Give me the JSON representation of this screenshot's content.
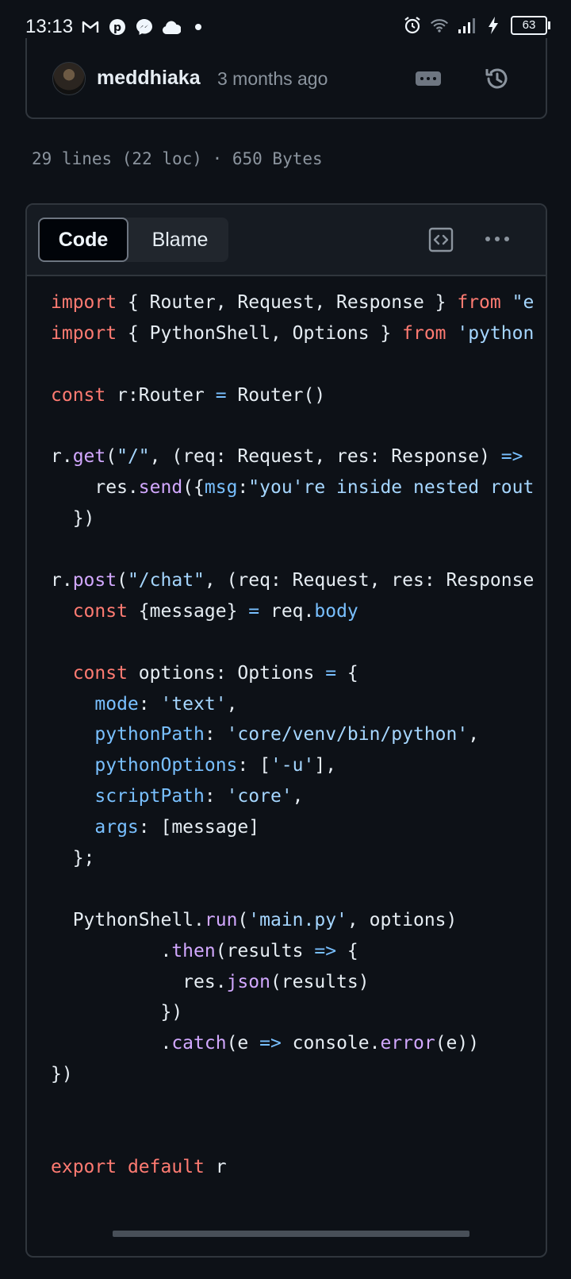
{
  "status_bar": {
    "time": "13:13",
    "left_icons": [
      "gmail-icon",
      "pinterest-icon",
      "messenger-icon",
      "cloud-app-icon",
      "dot-icon"
    ],
    "right_icons": [
      "alarm-icon",
      "wifi-icon",
      "signal-icon",
      "charging-icon"
    ],
    "battery": "63"
  },
  "commit": {
    "author": "meddhiaka",
    "time_ago": "3 months ago"
  },
  "file_info": "29 lines (22 loc) · 650 Bytes",
  "tabs": {
    "code_label": "Code",
    "blame_label": "Blame"
  },
  "colors": {
    "background": "#0d1117",
    "keyword": "#ff7b72",
    "string": "#a5d6ff",
    "property": "#79c0ff",
    "function": "#d2a8ff",
    "border": "#30363d"
  },
  "code_lines": [
    [
      [
        "kw",
        "import"
      ],
      [
        "t",
        " { Router, Request, Response } "
      ],
      [
        "kw",
        "from"
      ],
      [
        "t",
        " "
      ],
      [
        "str",
        "\"e"
      ]
    ],
    [
      [
        "kw",
        "import"
      ],
      [
        "t",
        " { PythonShell, Options } "
      ],
      [
        "kw",
        "from"
      ],
      [
        "t",
        " "
      ],
      [
        "str",
        "'python"
      ]
    ],
    [],
    [
      [
        "kw",
        "const"
      ],
      [
        "t",
        " r:Router "
      ],
      [
        "op",
        "="
      ],
      [
        "t",
        " Router()"
      ]
    ],
    [],
    [
      [
        "t",
        "r."
      ],
      [
        "fn",
        "get"
      ],
      [
        "t",
        "("
      ],
      [
        "str",
        "\"/\""
      ],
      [
        "t",
        ", (req: Request, res: Response) "
      ],
      [
        "op",
        "=>"
      ]
    ],
    [
      [
        "t",
        "    res."
      ],
      [
        "fn",
        "send"
      ],
      [
        "t",
        "({"
      ],
      [
        "prop",
        "msg"
      ],
      [
        "t",
        ":"
      ],
      [
        "str",
        "\"you're inside nested rout"
      ]
    ],
    [
      [
        "t",
        "  })"
      ]
    ],
    [],
    [
      [
        "t",
        "r."
      ],
      [
        "fn",
        "post"
      ],
      [
        "t",
        "("
      ],
      [
        "str",
        "\"/chat\""
      ],
      [
        "t",
        ", (req: Request, res: Response"
      ]
    ],
    [
      [
        "t",
        "  "
      ],
      [
        "kw",
        "const"
      ],
      [
        "t",
        " {message} "
      ],
      [
        "op",
        "="
      ],
      [
        "t",
        " req."
      ],
      [
        "prop",
        "body"
      ]
    ],
    [],
    [
      [
        "t",
        "  "
      ],
      [
        "kw",
        "const"
      ],
      [
        "t",
        " options: Options "
      ],
      [
        "op",
        "="
      ],
      [
        "t",
        " {"
      ]
    ],
    [
      [
        "t",
        "    "
      ],
      [
        "prop",
        "mode"
      ],
      [
        "t",
        ": "
      ],
      [
        "str",
        "'text'"
      ],
      [
        "t",
        ","
      ]
    ],
    [
      [
        "t",
        "    "
      ],
      [
        "prop",
        "pythonPath"
      ],
      [
        "t",
        ": "
      ],
      [
        "str",
        "'core/venv/bin/python'"
      ],
      [
        "t",
        ","
      ]
    ],
    [
      [
        "t",
        "    "
      ],
      [
        "prop",
        "pythonOptions"
      ],
      [
        "t",
        ": ["
      ],
      [
        "str",
        "'-u'"
      ],
      [
        "t",
        "],"
      ]
    ],
    [
      [
        "t",
        "    "
      ],
      [
        "prop",
        "scriptPath"
      ],
      [
        "t",
        ": "
      ],
      [
        "str",
        "'core'"
      ],
      [
        "t",
        ","
      ]
    ],
    [
      [
        "t",
        "    "
      ],
      [
        "prop",
        "args"
      ],
      [
        "t",
        ": [message]"
      ]
    ],
    [
      [
        "t",
        "  };"
      ]
    ],
    [],
    [
      [
        "t",
        "  PythonShell."
      ],
      [
        "fn",
        "run"
      ],
      [
        "t",
        "("
      ],
      [
        "str",
        "'main.py'"
      ],
      [
        "t",
        ", options)"
      ]
    ],
    [
      [
        "t",
        "          ."
      ],
      [
        "fn",
        "then"
      ],
      [
        "t",
        "(results "
      ],
      [
        "op",
        "=>"
      ],
      [
        "t",
        " {"
      ]
    ],
    [
      [
        "t",
        "            res."
      ],
      [
        "fn",
        "json"
      ],
      [
        "t",
        "(results)"
      ]
    ],
    [
      [
        "t",
        "          })"
      ]
    ],
    [
      [
        "t",
        "          ."
      ],
      [
        "fn",
        "catch"
      ],
      [
        "t",
        "(e "
      ],
      [
        "op",
        "=>"
      ],
      [
        "t",
        " console."
      ],
      [
        "fn",
        "error"
      ],
      [
        "t",
        "(e))"
      ]
    ],
    [
      [
        "t",
        "})"
      ]
    ],
    [],
    [],
    [
      [
        "kw",
        "export"
      ],
      [
        "t",
        " "
      ],
      [
        "kw",
        "default"
      ],
      [
        "t",
        " r"
      ]
    ]
  ]
}
